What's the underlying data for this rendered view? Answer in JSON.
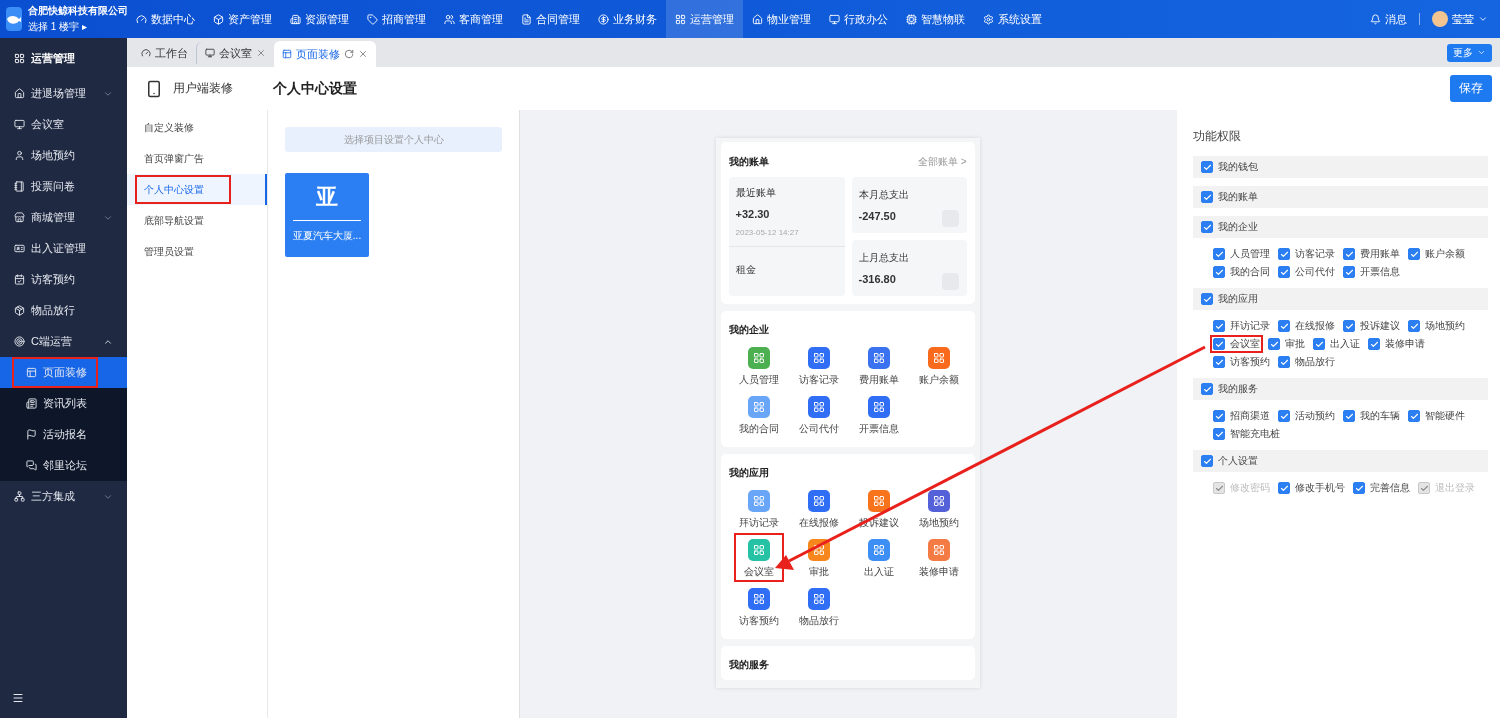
{
  "brand": {
    "company": "合肥快鲸科技有限公司",
    "project": "选择 1 楼宇",
    "caret": "▸"
  },
  "top_nav": [
    {
      "label": "数据中心",
      "selected": false
    },
    {
      "label": "资产管理",
      "selected": false
    },
    {
      "label": "资源管理",
      "selected": false
    },
    {
      "label": "招商管理",
      "selected": false
    },
    {
      "label": "客商管理",
      "selected": false
    },
    {
      "label": "合同管理",
      "selected": false
    },
    {
      "label": "业务财务",
      "selected": false
    },
    {
      "label": "运营管理",
      "selected": true
    },
    {
      "label": "物业管理",
      "selected": false
    },
    {
      "label": "行政办公",
      "selected": false
    },
    {
      "label": "智慧物联",
      "selected": false
    },
    {
      "label": "系统设置",
      "selected": false
    }
  ],
  "user_bar": {
    "messages": "消息",
    "user": "莹莹"
  },
  "sidebar": {
    "title": "运营管理",
    "items": [
      {
        "label": "进退场管理",
        "expanded": false
      },
      {
        "label": "会议室"
      },
      {
        "label": "场地预约"
      },
      {
        "label": "投票问卷"
      },
      {
        "label": "商城管理",
        "expanded": false
      },
      {
        "label": "出入证管理"
      },
      {
        "label": "访客预约"
      },
      {
        "label": "物品放行"
      },
      {
        "label": "C端运营",
        "expanded": true,
        "children": [
          {
            "label": "页面装修",
            "selected": true,
            "highlighted": true
          },
          {
            "label": "资讯列表",
            "selected": false,
            "highlighted": false
          },
          {
            "label": "活动报名",
            "selected": false,
            "highlighted": false
          },
          {
            "label": "邻里论坛",
            "selected": false,
            "highlighted": false
          }
        ]
      },
      {
        "label": "三方集成",
        "expanded": false
      }
    ]
  },
  "tabs": [
    {
      "label": "工作台",
      "selected": false,
      "closable": false,
      "refresh": false
    },
    {
      "label": "会议室",
      "selected": false,
      "closable": true,
      "refresh": false
    },
    {
      "label": "页面装修",
      "selected": true,
      "closable": true,
      "refresh": true
    }
  ],
  "more_button": "更多",
  "header": {
    "section": "用户端装修",
    "title": "个人中心设置",
    "save": "保存"
  },
  "submenu": [
    {
      "label": "自定义装修",
      "selected": false,
      "highlighted": false
    },
    {
      "label": "首页弹窗广告",
      "selected": false,
      "highlighted": false
    },
    {
      "label": "个人中心设置",
      "selected": true,
      "highlighted": true
    },
    {
      "label": "底部导航设置",
      "selected": false,
      "highlighted": false
    },
    {
      "label": "管理员设置",
      "selected": false,
      "highlighted": false
    }
  ],
  "projects": {
    "select": "选择项目设置个人中心",
    "items": [
      {
        "initial": "亚",
        "name": "亚夏汽车大厦..."
      }
    ]
  },
  "preview": {
    "bills": {
      "title": "我的账单",
      "link": "全部账单 >",
      "recent": {
        "label": "最近账单",
        "amount": "+32.30",
        "date": "2023-05-12 14:27",
        "type": "租金"
      },
      "cards": [
        {
          "label": "本月总支出",
          "amount": "-247.50"
        },
        {
          "label": "上月总支出",
          "amount": "-316.80"
        }
      ]
    },
    "sections": [
      {
        "title": "我的企业",
        "apps": [
          {
            "label": "人员管理",
            "color": "#4caf50",
            "highlighted": false
          },
          {
            "label": "访客记录",
            "color": "#2f6ef5",
            "highlighted": false
          },
          {
            "label": "费用账单",
            "color": "#3a72f0",
            "highlighted": false
          },
          {
            "label": "账户余额",
            "color": "#fa6a1c",
            "highlighted": false
          },
          {
            "label": "我的合同",
            "color": "#6aa6f8",
            "highlighted": false
          },
          {
            "label": "公司代付",
            "color": "#2f6ef5",
            "highlighted": false
          },
          {
            "label": "开票信息",
            "color": "#2f6ef5",
            "highlighted": false
          }
        ]
      },
      {
        "title": "我的应用",
        "apps": [
          {
            "label": "拜访记录",
            "color": "#6aa6f8",
            "highlighted": false
          },
          {
            "label": "在线报修",
            "color": "#2f6ef5",
            "highlighted": false
          },
          {
            "label": "投诉建议",
            "color": "#f7741d",
            "highlighted": false
          },
          {
            "label": "场地预约",
            "color": "#5461d8",
            "highlighted": false
          },
          {
            "label": "会议室",
            "color": "#25c2a6",
            "highlighted": true
          },
          {
            "label": "审批",
            "color": "#f7861d",
            "highlighted": false
          },
          {
            "label": "出入证",
            "color": "#3d8ef5",
            "highlighted": false
          },
          {
            "label": "装修申请",
            "color": "#f47b44",
            "highlighted": false
          },
          {
            "label": "访客预约",
            "color": "#2f6ef5",
            "highlighted": false
          },
          {
            "label": "物品放行",
            "color": "#2f6ef5",
            "highlighted": false
          }
        ]
      },
      {
        "title": "我的服务"
      }
    ]
  },
  "permissions": {
    "title": "功能权限",
    "groups": [
      {
        "label": "我的钱包",
        "checked": true
      },
      {
        "label": "我的账单",
        "checked": true
      },
      {
        "label": "我的企业",
        "checked": true,
        "items": [
          {
            "label": "人员管理",
            "checked": true,
            "disabled": false,
            "highlighted": false
          },
          {
            "label": "访客记录",
            "checked": true,
            "disabled": false,
            "highlighted": false
          },
          {
            "label": "费用账单",
            "checked": true,
            "disabled": false,
            "highlighted": false
          },
          {
            "label": "账户余额",
            "checked": true,
            "disabled": false,
            "highlighted": false
          },
          {
            "label": "我的合同",
            "checked": true,
            "disabled": false,
            "highlighted": false
          },
          {
            "label": "公司代付",
            "checked": true,
            "disabled": false,
            "highlighted": false
          },
          {
            "label": "开票信息",
            "checked": true,
            "disabled": false,
            "highlighted": false
          }
        ]
      },
      {
        "label": "我的应用",
        "checked": true,
        "items": [
          {
            "label": "拜访记录",
            "checked": true,
            "disabled": false,
            "highlighted": false
          },
          {
            "label": "在线报修",
            "checked": true,
            "disabled": false,
            "highlighted": false
          },
          {
            "label": "投诉建议",
            "checked": true,
            "disabled": false,
            "highlighted": false
          },
          {
            "label": "场地预约",
            "checked": true,
            "disabled": false,
            "highlighted": false
          },
          {
            "label": "会议室",
            "checked": true,
            "disabled": false,
            "highlighted": true
          },
          {
            "label": "审批",
            "checked": true,
            "disabled": false,
            "highlighted": false
          },
          {
            "label": "出入证",
            "checked": true,
            "disabled": false,
            "highlighted": false
          },
          {
            "label": "装修申请",
            "checked": true,
            "disabled": false,
            "highlighted": false
          },
          {
            "label": "访客预约",
            "checked": true,
            "disabled": false,
            "highlighted": false
          },
          {
            "label": "物品放行",
            "checked": true,
            "disabled": false,
            "highlighted": false
          }
        ]
      },
      {
        "label": "我的服务",
        "checked": true,
        "items": [
          {
            "label": "招商渠道",
            "checked": true,
            "disabled": false,
            "highlighted": false
          },
          {
            "label": "活动预约",
            "checked": true,
            "disabled": false,
            "highlighted": false
          },
          {
            "label": "我的车辆",
            "checked": true,
            "disabled": false,
            "highlighted": false
          },
          {
            "label": "智能硬件",
            "checked": true,
            "disabled": false,
            "highlighted": false
          },
          {
            "label": "智能充电桩",
            "checked": true,
            "disabled": false,
            "highlighted": false
          }
        ]
      },
      {
        "label": "个人设置",
        "checked": true,
        "items": [
          {
            "label": "修改密码",
            "checked": true,
            "disabled": true,
            "highlighted": false
          },
          {
            "label": "修改手机号",
            "checked": true,
            "disabled": false,
            "highlighted": false
          },
          {
            "label": "完善信息",
            "checked": true,
            "disabled": false,
            "highlighted": false
          },
          {
            "label": "退出登录",
            "checked": true,
            "disabled": true,
            "highlighted": false
          }
        ]
      }
    ]
  }
}
